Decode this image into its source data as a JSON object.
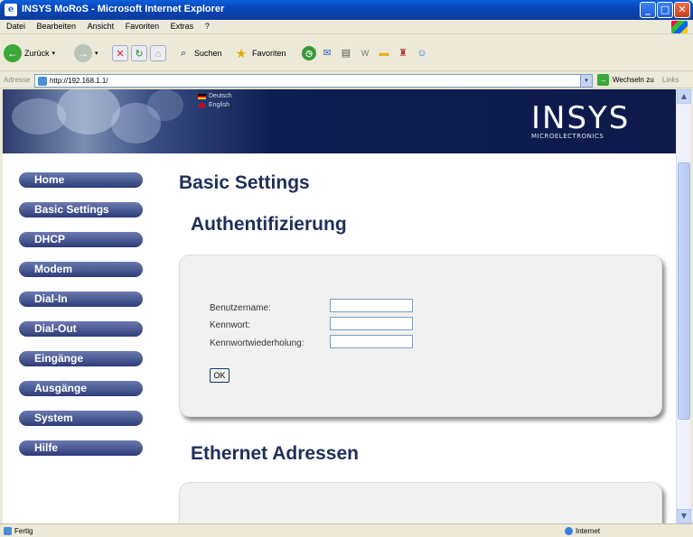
{
  "window": {
    "title": "INSYS MoRoS - Microsoft Internet Explorer"
  },
  "menu": [
    "Datei",
    "Bearbeiten",
    "Ansicht",
    "Favoriten",
    "Extras",
    "?"
  ],
  "toolbar": {
    "back_label": "Zurück",
    "search_label": "Suchen",
    "favorites_label": "Favoriten"
  },
  "address": {
    "label": "Adresse",
    "url": "http://192.168.1.1/",
    "go_label": "Wechseln zu",
    "links_label": "Links"
  },
  "banner": {
    "languages": [
      "Deutsch",
      "English"
    ],
    "logo_big": "INSYS",
    "logo_small": "MICROELECTRONICS"
  },
  "nav": [
    "Home",
    "Basic Settings",
    "DHCP",
    "Modem",
    "Dial-In",
    "Dial-Out",
    "Eingänge",
    "Ausgänge",
    "System",
    "Hilfe"
  ],
  "page": {
    "title": "Basic Settings",
    "section1": "Authentifizierung",
    "section2": "Ethernet Adressen"
  },
  "form": {
    "username_label": "Benutzername:",
    "password_label": "Kennwort:",
    "password_repeat_label": "Kennwortwiederholung:",
    "ok_label": "OK"
  },
  "status": {
    "left": "Fertig",
    "right": "Internet"
  },
  "colors": {
    "nav_bg": "#2e3d78",
    "heading": "#1f2f5a",
    "banner": "#0d1a4a"
  }
}
